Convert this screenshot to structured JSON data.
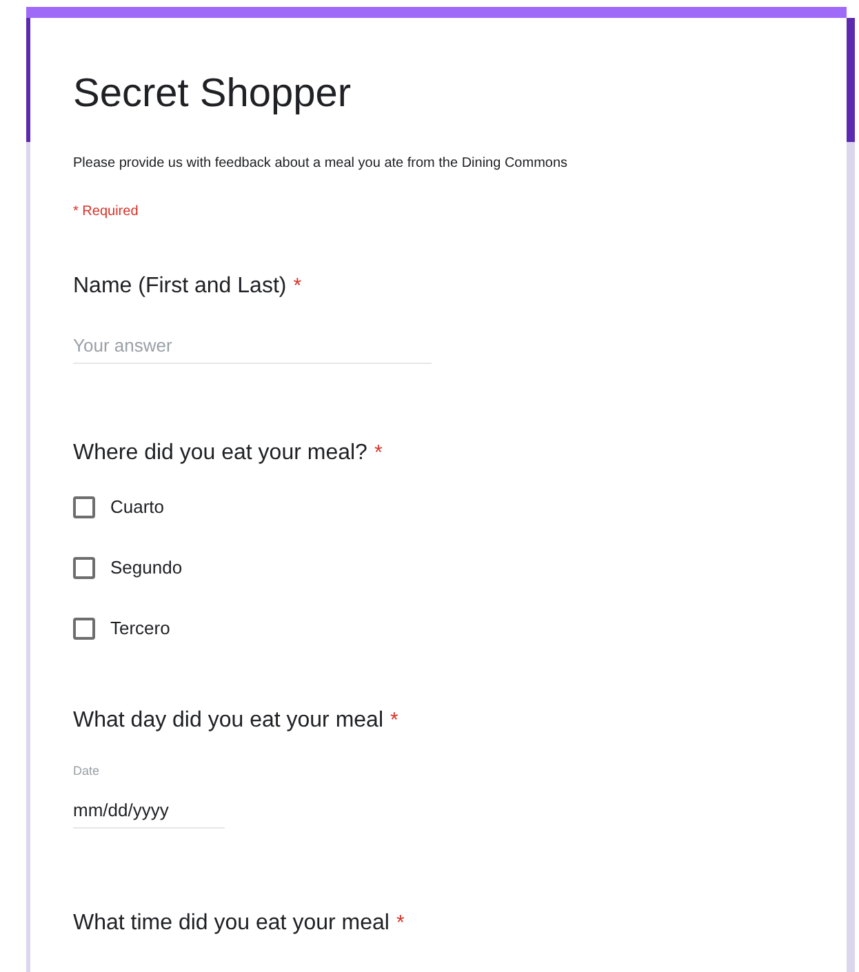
{
  "form": {
    "title": "Secret Shopper",
    "description": "Please provide us with feedback about a meal you ate from the Dining Commons",
    "required_note": "* Required"
  },
  "questions": [
    {
      "kind": "text",
      "label": "Name (First and Last)",
      "required_mark": "*",
      "placeholder": "Your answer"
    },
    {
      "kind": "checkbox",
      "label": "Where did you eat your meal?",
      "required_mark": "*",
      "options": [
        {
          "label": "Cuarto",
          "checked": false
        },
        {
          "label": "Segundo",
          "checked": false
        },
        {
          "label": "Tercero",
          "checked": false
        }
      ]
    },
    {
      "kind": "date",
      "label": "What day did you eat your meal",
      "required_mark": "*",
      "field_label": "Date",
      "placeholder": "mm/dd/yyyy"
    },
    {
      "kind": "heading",
      "label": "What time did you eat your meal",
      "required_mark": "*"
    }
  ]
}
